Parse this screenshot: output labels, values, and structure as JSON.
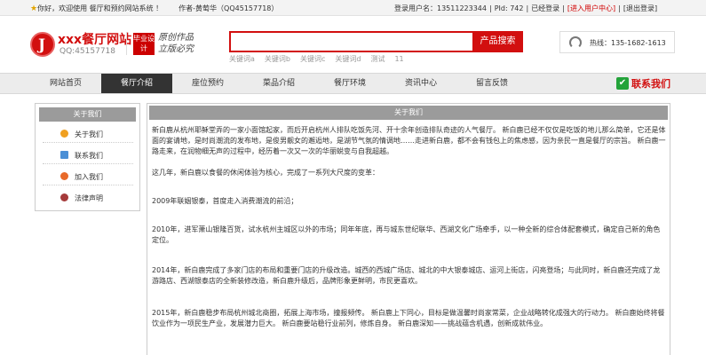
{
  "topbar": {
    "greeting": "你好，欢迎使用 餐厅和预约网站系统 ！",
    "author": "作者-黄萄华（QQ45157718）",
    "username": "登录用户名：13511223344",
    "pid": "PId: 742",
    "logged_in": "已经登录",
    "enter_center": "[进入用户中心]",
    "logout": "[退出登录]"
  },
  "header": {
    "logo_letter": "J",
    "logo_name": "xxx餐厅网站",
    "logo_qq": "QQ:45157718",
    "badge": "毕业设计",
    "slogan": "原创作品 立版必究",
    "search_value": "",
    "search_button": "产品搜索",
    "search_tags": [
      "关键词a",
      "关键词b",
      "关键词c",
      "关键词d",
      "测试",
      "11"
    ],
    "hotline": "热线：135-1682-1613"
  },
  "nav": {
    "items": [
      "网站首页",
      "餐厅介绍",
      "座位预约",
      "菜品介绍",
      "餐厅环境",
      "资讯中心",
      "留言反馈"
    ],
    "contact": "联系我们"
  },
  "sidebar": {
    "title": "关于我们",
    "items": [
      {
        "label": "关于我们",
        "icon": "orange-dot-icon",
        "color": "#f0a020"
      },
      {
        "label": "联系我们",
        "icon": "document-icon",
        "color": "#4a8fd6"
      },
      {
        "label": "加入我们",
        "icon": "add-icon",
        "color": "#e86a2a"
      },
      {
        "label": "法律声明",
        "icon": "legal-icon",
        "color": "#a53a3a"
      }
    ]
  },
  "main": {
    "title": "关于我们",
    "paragraphs": [
      "新白鹿从杭州耶稣堂弄的一家小面馆起家，而后开启杭州人排队吃饭先河、开十余年创造排队奇迹的人气餐厅。 新白鹿已经不仅仅是吃饭的地儿那么简单，它还是体面的宴请地，是时尚潮流的发布地，是俊男靓女的邂逅地，是湖节气氛的情调地……走进新白鹿，都不会有钱包上的焦虑感，因为亲民一直是餐厅的宗旨。 新白鹿一路走来，在润物细无声的过程中，经历着一次又一次的华丽蜕变与自我超越。",
      "这几年，新白鹿以食餐的休闲体验为核心，完成了一系列大尺度的变革：",
      "2009年联姻银泰，首度走入消费潮流的前沿；",
      "2010年，进军萧山银隆百货，试水杭州主城区以外的市场；同年年底，再与城东世纪联华、西湖文化广场牵手，以一种全新的综合体配套模式，确定自己新的角色定位。",
      "2014年，新白鹿完成了多家门店的布局和重要门店的升级改造。城西的西城广场店、城北的中大银泰城店、运河上街店，闪亮登场；与此同时，新白鹿还完成了龙游路店、西湖银泰店的全新装修改造，新白鹿升级后，品牌形象更鲜明，市民更喜欢。",
      "2015年，新白鹿稳步布局杭州城北商圈，拓展上海市场，撞报频传。 新白鹿上下同心，目标是做温馨时尚家常菜，企业战略转化成强大的行动力。 新白鹿始终将餐饮业作为一项民生产业，发展潜力巨大。 新白鹿要站稳行业前列，修炼自身。 新白鹿深知——挑战蕴含机遇，创新成就伟业。"
    ]
  }
}
